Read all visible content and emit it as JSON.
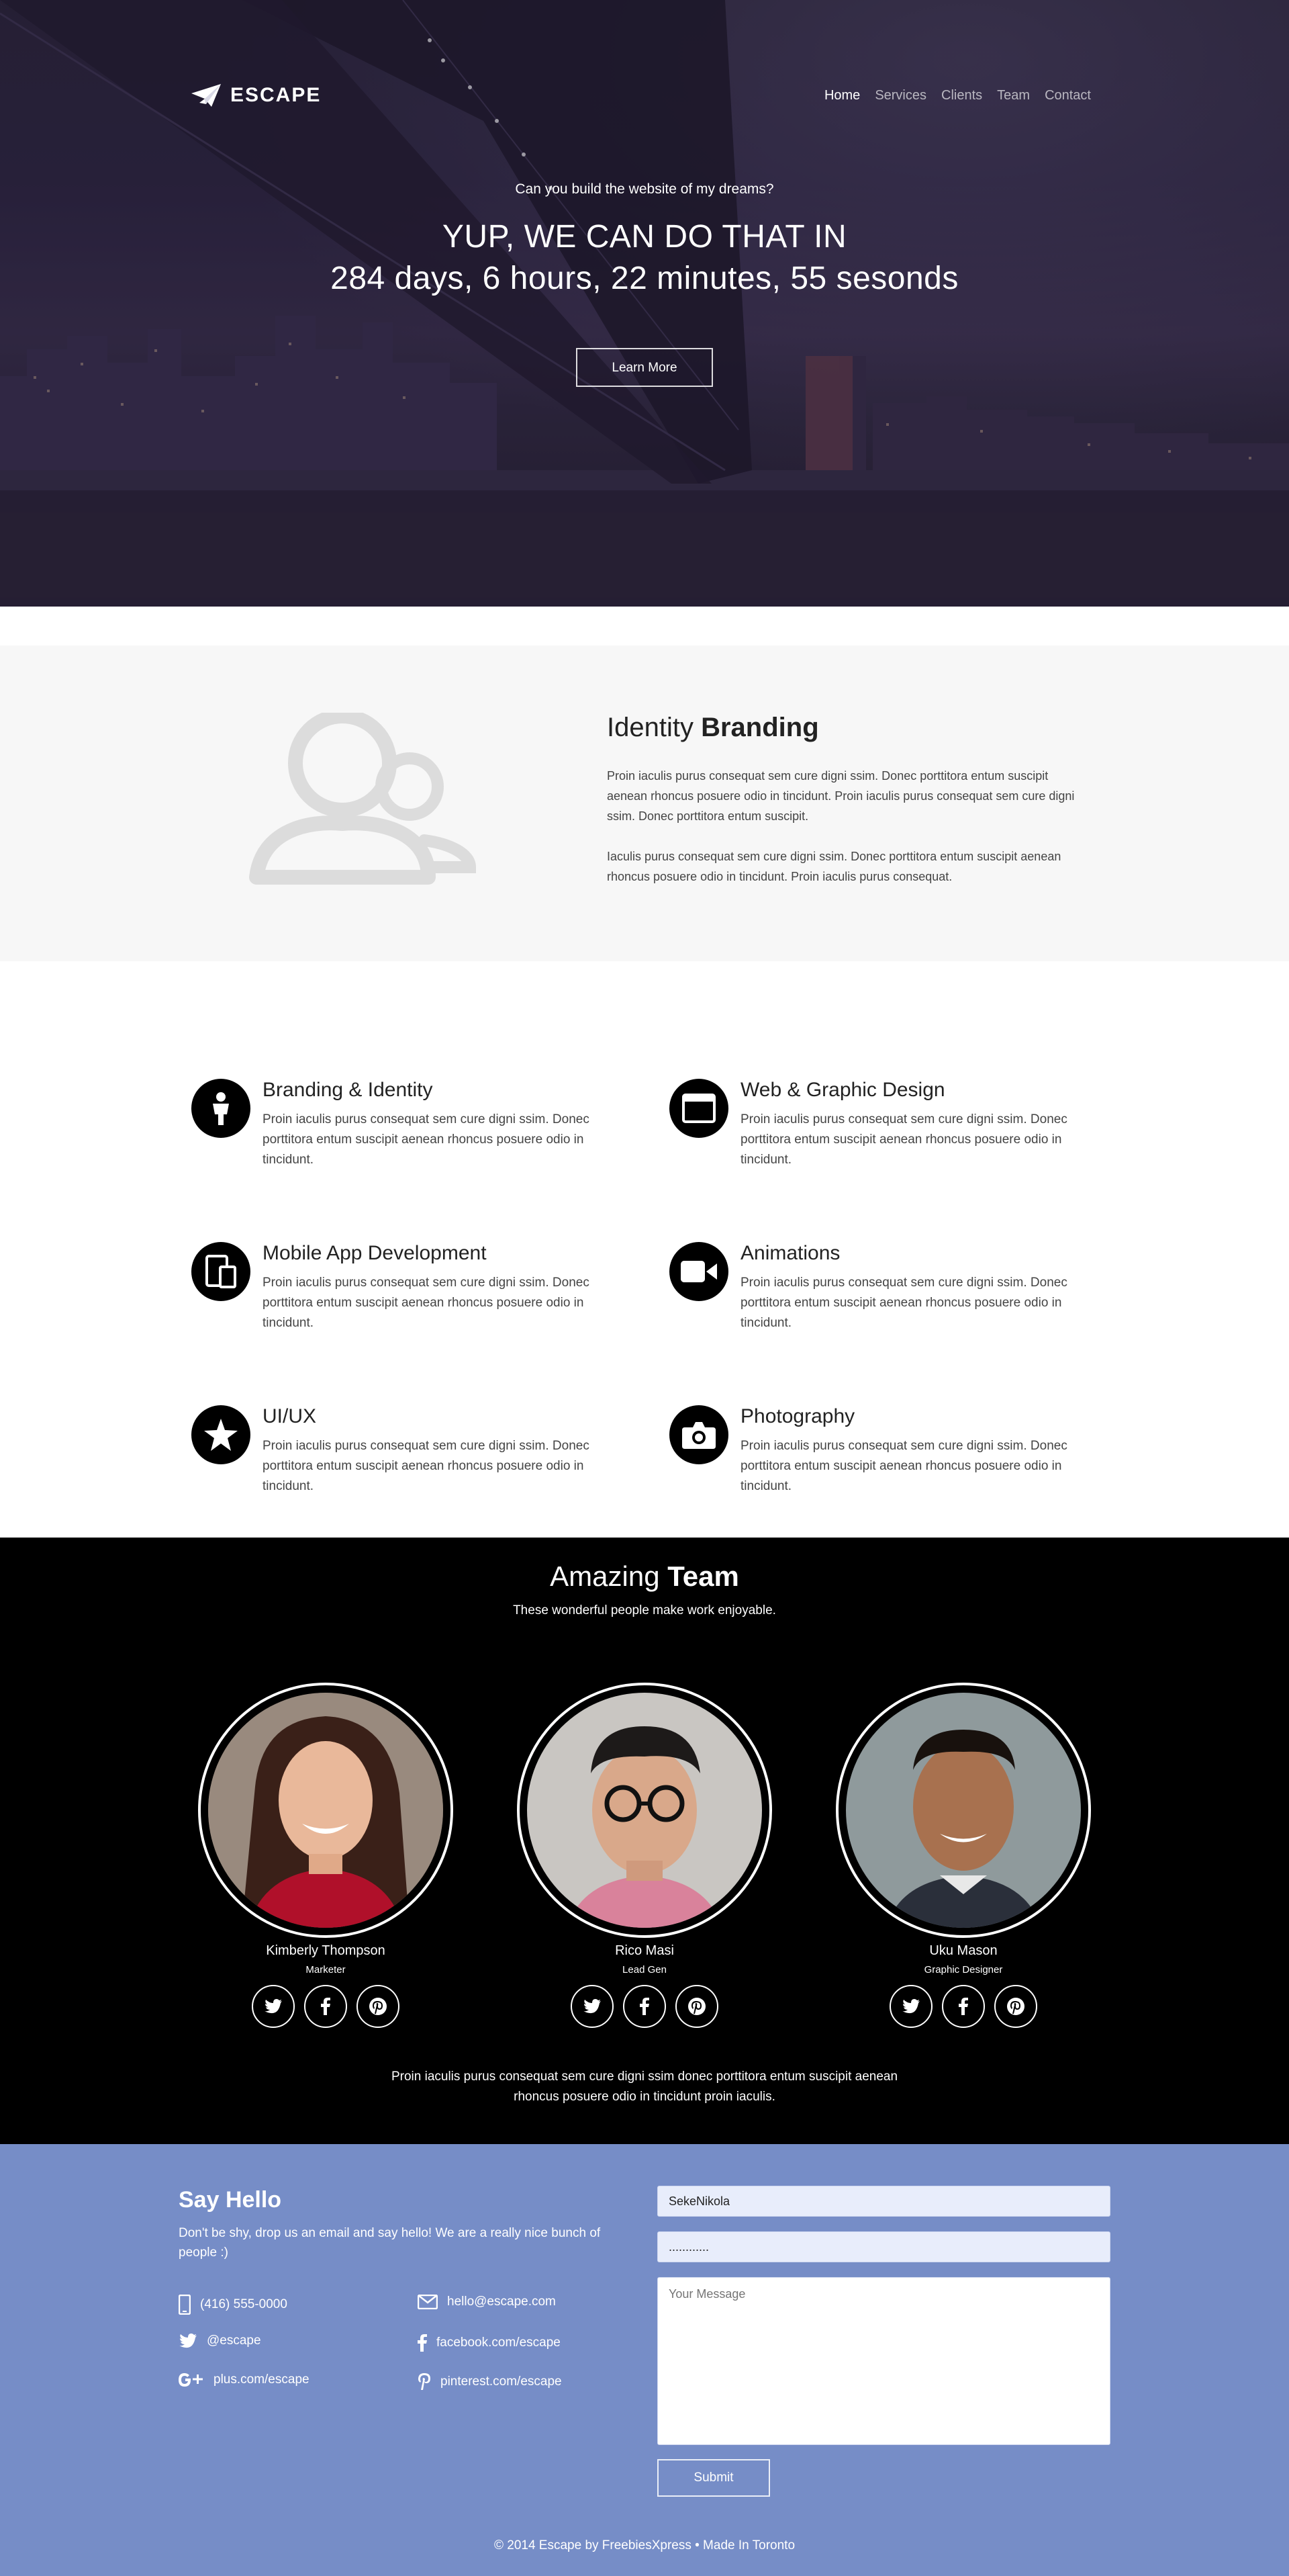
{
  "nav": {
    "brand": "ESCAPE",
    "links": [
      "Home",
      "Services",
      "Clients",
      "Team",
      "Contact"
    ],
    "active": "Home"
  },
  "hero": {
    "subtitle": "Can you build the website of my dreams?",
    "title_line1": "YUP, WE CAN DO THAT IN",
    "title_line2": "284 days, 6 hours, 22 minutes, 55 sesonds",
    "button": "Learn More"
  },
  "identity": {
    "title_light": "Identity ",
    "title_bold": "Branding",
    "para1": "Proin iaculis purus consequat sem cure digni ssim. Donec porttitora entum suscipit aenean rhoncus posuere odio in tincidunt. Proin iaculis purus consequat sem cure digni ssim. Donec porttitora entum suscipit.",
    "para2": "Iaculis purus consequat sem cure digni ssim. Donec porttitora entum suscipit aenean rhoncus posuere odio in tincidunt. Proin iaculis purus consequat."
  },
  "services": [
    {
      "title": "Branding & Identity",
      "text": "Proin iaculis purus consequat sem cure digni ssim. Donec porttitora entum suscipit aenean rhoncus posuere odio in tincidunt.",
      "icon": "user-icon"
    },
    {
      "title": "Web & Graphic Design",
      "text": "Proin iaculis purus consequat sem cure digni ssim. Donec porttitora entum suscipit aenean rhoncus posuere odio in tincidunt.",
      "icon": "browser-window-icon"
    },
    {
      "title": "Mobile App Development",
      "text": "Proin iaculis purus consequat sem cure digni ssim. Donec porttitora entum suscipit aenean rhoncus posuere odio in tincidunt.",
      "icon": "devices-icon"
    },
    {
      "title": "Animations",
      "text": "Proin iaculis purus consequat sem cure digni ssim. Donec porttitora entum suscipit aenean rhoncus posuere odio in tincidunt.",
      "icon": "video-camera-icon"
    },
    {
      "title": "UI/UX",
      "text": "Proin iaculis purus consequat sem cure digni ssim. Donec porttitora entum suscipit aenean rhoncus posuere odio in tincidunt.",
      "icon": "star-icon"
    },
    {
      "title": "Photography",
      "text": "Proin iaculis purus consequat sem cure digni ssim. Donec porttitora entum suscipit aenean rhoncus posuere odio in tincidunt.",
      "icon": "camera-icon"
    }
  ],
  "team": {
    "title_light": "Amazing ",
    "title_bold": "Team",
    "tagline": "These wonderful people make work enjoyable.",
    "members": [
      {
        "name": "Kimberly Thompson",
        "role": "Marketer"
      },
      {
        "name": "Rico Masi",
        "role": "Lead Gen"
      },
      {
        "name": "Uku Mason",
        "role": "Graphic Designer"
      }
    ],
    "blurb": "Proin iaculis purus consequat sem cure digni ssim donec porttitora entum suscipit aenean rhoncus posuere odio in tincidunt proin iaculis."
  },
  "contact": {
    "title": "Say Hello",
    "intro": "Don't be shy, drop us an email and say hello! We are a really nice bunch of people :)",
    "phone": "(416) 555-0000",
    "email": "hello@escape.com",
    "twitter": "@escape",
    "facebook": "facebook.com/escape",
    "gplus": "plus.com/escape",
    "pinterest": "pinterest.com/escape",
    "form": {
      "name_value": "SekeNikola",
      "password_value": "............",
      "message_placeholder": "Your Message",
      "submit": "Submit"
    }
  },
  "footer": {
    "copyright": "© 2014 Escape by FreebiesXpress • Made In Toronto"
  },
  "colors": {
    "contact_bg": "#768dc7",
    "team_bg": "#000000",
    "identity_bg": "#f7f7f7"
  }
}
